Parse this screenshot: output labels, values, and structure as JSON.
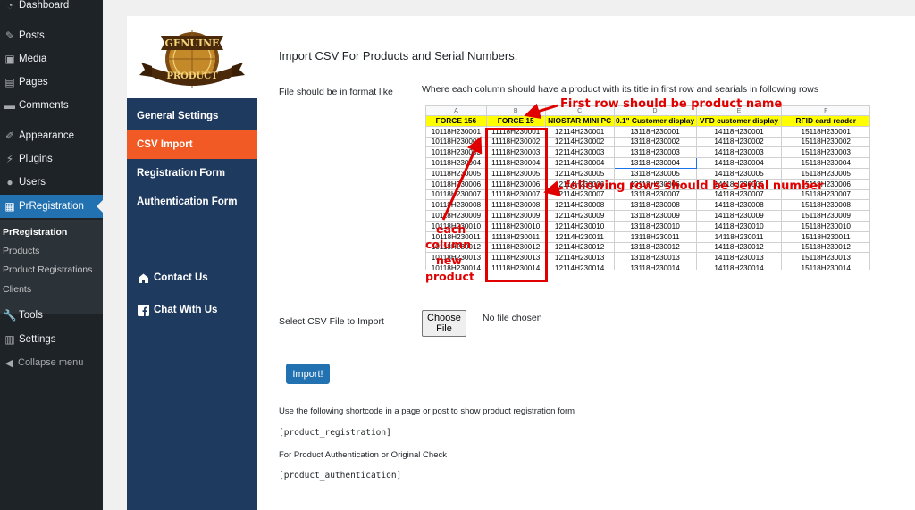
{
  "wp_menu": {
    "items": [
      {
        "label": "Dashboard",
        "icon": "dashboard-icon"
      },
      {
        "label": "Posts",
        "icon": "pin-icon"
      },
      {
        "label": "Media",
        "icon": "media-icon"
      },
      {
        "label": "Pages",
        "icon": "pages-icon"
      },
      {
        "label": "Comments",
        "icon": "comments-icon"
      },
      {
        "label": "Appearance",
        "icon": "brush-icon"
      },
      {
        "label": "Plugins",
        "icon": "plug-icon"
      },
      {
        "label": "Users",
        "icon": "user-icon"
      },
      {
        "label": "PrRegistration",
        "icon": "plugin-icon"
      },
      {
        "label": "Tools",
        "icon": "wrench-icon"
      },
      {
        "label": "Settings",
        "icon": "settings-icon"
      }
    ],
    "submenu": [
      "PrRegistration",
      "Products",
      "Product Registrations",
      "Clients"
    ],
    "collapse_label": "Collapse menu"
  },
  "logo": {
    "top": "GENUINE",
    "bottom": "PRODUCT"
  },
  "plugin_nav": {
    "general": "General Settings",
    "csv": "CSV Import",
    "registration": "Registration Form",
    "authentication": "Authentication Form",
    "contact": "Contact Us",
    "chat": "Chat With Us"
  },
  "content": {
    "title": "Import CSV For Products and Serial Numbers.",
    "format_label": "File should be in format like",
    "format_desc": "Where each column should have a product with its title in first row and searials in following rows",
    "select_label": "Select CSV File to Import",
    "choose_button": "Choose File",
    "no_file": "No file chosen",
    "import_button": "Import!",
    "shortcode_desc1": "Use the following shortcode in a page or post to show product registration form",
    "shortcode1": "[product_registration]",
    "shortcode_desc2": "For Product Authentication or Original Check",
    "shortcode2": "[product_authentication]"
  },
  "sheet": {
    "col_letters": [
      "A",
      "B",
      "C",
      "D",
      "E",
      "F"
    ],
    "titles": [
      "FORCE 156",
      "FORCE 15",
      "NIOSTAR MINI PC",
      "0.1\" Customer display",
      "VFD customer display",
      "RFID card reader"
    ],
    "rows": [
      [
        "10118H230001",
        "11118H230001",
        "12114H230001",
        "13118H230001",
        "14118H230001",
        "15118H230001"
      ],
      [
        "10118H230002",
        "11118H230002",
        "12114H230002",
        "13118H230002",
        "14118H230002",
        "15118H230002"
      ],
      [
        "10118H230003",
        "11118H230003",
        "12114H230003",
        "13118H230003",
        "14118H230003",
        "15118H230003"
      ],
      [
        "10118H230004",
        "11118H230004",
        "12114H230004",
        "13118H230004",
        "14118H230004",
        "15118H230004"
      ],
      [
        "10118H230005",
        "11118H230005",
        "12114H230005",
        "13118H230005",
        "14118H230005",
        "15118H230005"
      ],
      [
        "10118H230006",
        "11118H230006",
        "12114H230006",
        "13118H230006",
        "14118H230006",
        "15118H230006"
      ],
      [
        "10118H230007",
        "11118H230007",
        "12114H230007",
        "13118H230007",
        "14118H230007",
        "15118H230007"
      ],
      [
        "10118H230008",
        "11118H230008",
        "12114H230008",
        "13118H230008",
        "14118H230008",
        "15118H230008"
      ],
      [
        "10118H230009",
        "11118H230009",
        "12114H230009",
        "13118H230009",
        "14118H230009",
        "15118H230009"
      ],
      [
        "10118H230010",
        "11118H230010",
        "12114H230010",
        "13118H230010",
        "14118H230010",
        "15118H230010"
      ],
      [
        "10118H230011",
        "11118H230011",
        "12114H230011",
        "13118H230011",
        "14118H230011",
        "15118H230011"
      ],
      [
        "10118H230012",
        "11118H230012",
        "12114H230012",
        "13118H230012",
        "14118H230012",
        "15118H230012"
      ],
      [
        "10118H230013",
        "11118H230013",
        "12114H230013",
        "13118H230013",
        "14118H230013",
        "15118H230013"
      ],
      [
        "10118H230014",
        "11118H230014",
        "12114H230014",
        "13118H230014",
        "14118H230014",
        "15118H230014"
      ]
    ]
  },
  "annotations": {
    "first_row": "First row should be product name",
    "following_rows": "following rows should be serial number",
    "each": "each",
    "column": "column",
    "new": "new",
    "product": "product"
  },
  "colors": {
    "accent": "#f15a24",
    "nav": "#1e3a5f",
    "wp_blue": "#2271b1",
    "annot": "#e00000"
  }
}
